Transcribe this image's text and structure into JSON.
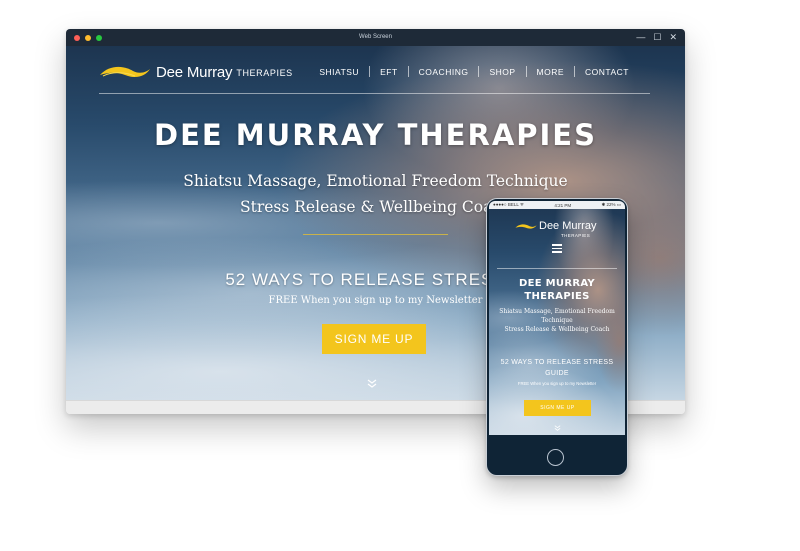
{
  "colors": {
    "titlebar": "#1e2a38",
    "accent_yellow": "#f3c51d",
    "gold_rule": "#c9b24a",
    "close_dot": "#ff5f57",
    "minimize_dot": "#febc2e",
    "zoom_dot": "#28c840",
    "phone_body": "#0f2436"
  },
  "window": {
    "title": "Web Screen",
    "controls": [
      "—",
      "☐",
      "✕"
    ]
  },
  "site": {
    "logo": {
      "name": "Dee Murray",
      "tagline": "THERAPIES",
      "icon": "swoosh-logo-icon"
    },
    "nav": [
      "SHIATSU",
      "EFT",
      "COACHING",
      "SHOP",
      "MORE",
      "CONTACT"
    ],
    "hero": {
      "title": "DEE MURRAY THERAPIES",
      "subtitle_line1": "Shiatsu Massage, Emotional Freedom Technique",
      "subtitle_line2": "Stress Release & Wellbeing Coach",
      "guide_title": "52 WAYS TO RELEASE STRESS G",
      "guide_subtitle": "FREE When you sign up to my Newsletter",
      "cta_label": "SIGN ME UP",
      "scroll_icon": "double-chevron-down-icon"
    }
  },
  "phone": {
    "status": {
      "carrier": "●●●●○ BELL ᯤ",
      "time": "4:21 PM",
      "battery": "✱ 22% ▭"
    },
    "logo": {
      "name": "Dee Murray",
      "tagline": "THERAPIES"
    },
    "menu_icon": "hamburger-menu-icon",
    "title_line1": "DEE MURRAY",
    "title_line2": "THERAPIES",
    "subtitle_line1": "Shiatsu Massage, Emotional Freedom",
    "subtitle_line2": "Technique",
    "subtitle_line3": "Stress Release & Wellbeing Coach",
    "guide_line1": "52 WAYS TO RELEASE STRESS",
    "guide_line2": "GUIDE",
    "guide_subtitle": "FREE When you sign up to my Newsletter",
    "cta_label": "SIGN ME UP"
  }
}
